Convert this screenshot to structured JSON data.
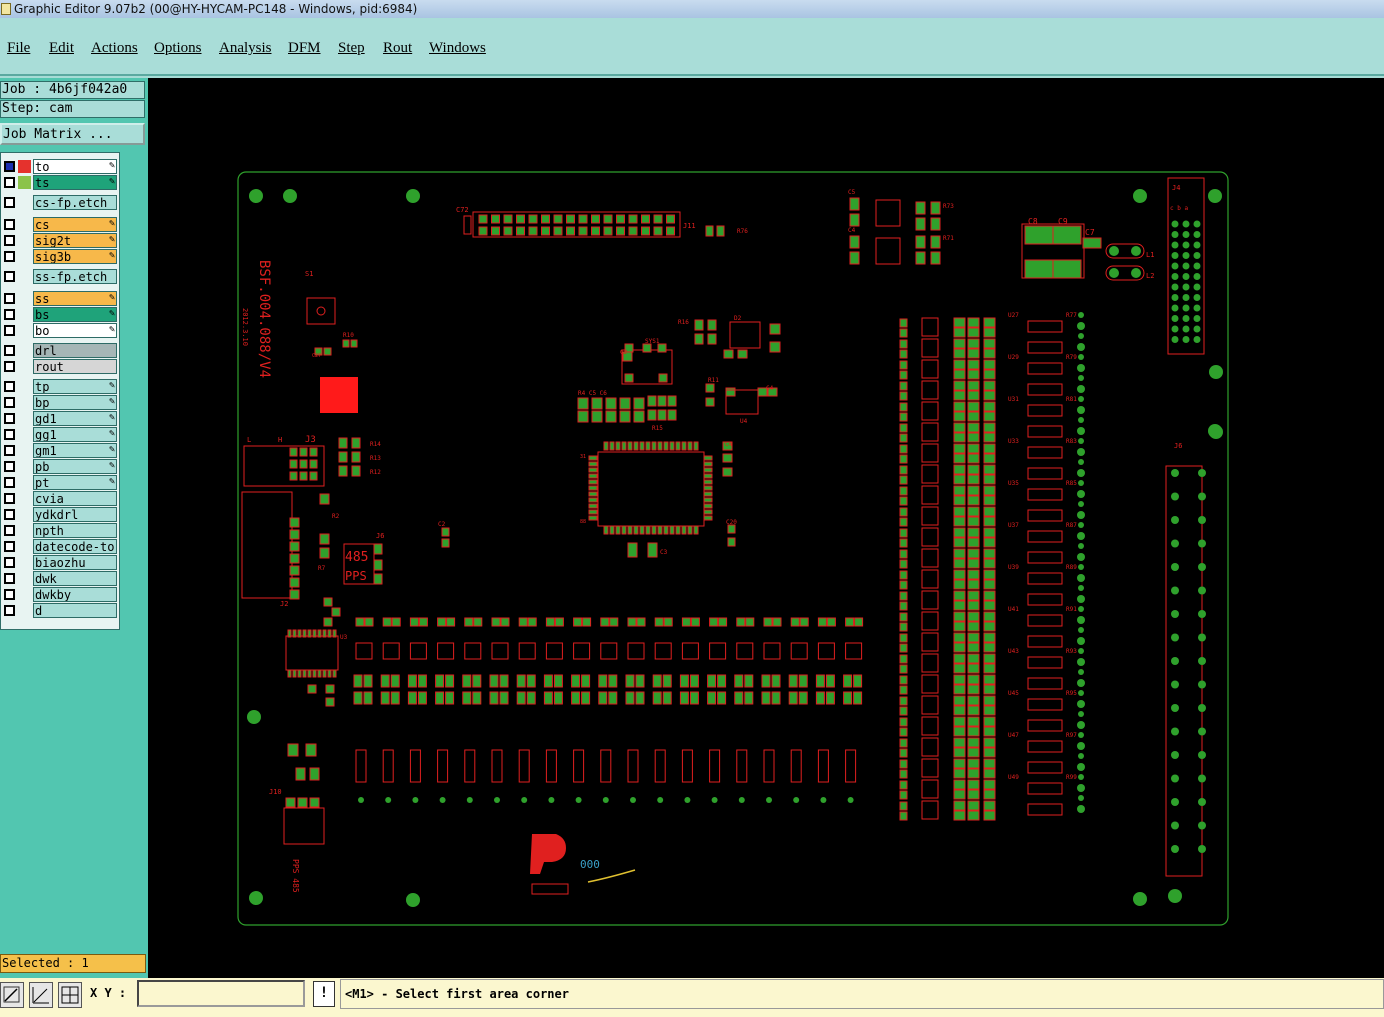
{
  "window": {
    "title": "Graphic Editor 9.07b2 (00@HY-HYCAM-PC148 - Windows, pid:6984)"
  },
  "menu": [
    "File",
    "Edit",
    "Actions",
    "Options",
    "Analysis",
    "DFM",
    "Step",
    "Rout",
    "Windows"
  ],
  "job": {
    "job_line": "Job : 4b6jf042a0",
    "step_line": "Step: cam",
    "matrix_button": "Job Matrix ..."
  },
  "layers": [
    {
      "name": "to",
      "color": "#ffffff"
    },
    {
      "name": "ts",
      "color": "#1fa37a"
    },
    {
      "name": "cs-fp.etch",
      "color": "#a9ddd8"
    },
    {
      "name": "cs",
      "color": "#f7b84a"
    },
    {
      "name": "sig2t",
      "color": "#f7b84a"
    },
    {
      "name": "sig3b",
      "color": "#f7b84a"
    },
    {
      "name": "ss-fp.etch",
      "color": "#a9ddd8"
    },
    {
      "name": "ss",
      "color": "#f7b84a"
    },
    {
      "name": "bs",
      "color": "#1fa37a"
    },
    {
      "name": "bo",
      "color": "#ffffff"
    },
    {
      "name": "drl",
      "color": "#a5b6b6"
    },
    {
      "name": "rout",
      "color": "#d6d6d6"
    },
    {
      "name": "tp",
      "color": "#a9ddd8"
    },
    {
      "name": "bp",
      "color": "#a9ddd8"
    },
    {
      "name": "gd1",
      "color": "#a9ddd8"
    },
    {
      "name": "gg1",
      "color": "#a9ddd8"
    },
    {
      "name": "gm1",
      "color": "#a9ddd8"
    },
    {
      "name": "pb",
      "color": "#a9ddd8"
    },
    {
      "name": "pt",
      "color": "#a9ddd8"
    },
    {
      "name": "cvia",
      "color": "#a9ddd8"
    },
    {
      "name": "ydkdrl",
      "color": "#a9ddd8"
    },
    {
      "name": "npth",
      "color": "#a9ddd8"
    },
    {
      "name": "datecode-to",
      "color": "#a9ddd8"
    },
    {
      "name": "biaozhu",
      "color": "#a9ddd8"
    },
    {
      "name": "dwk",
      "color": "#a9ddd8"
    },
    {
      "name": "dwkby",
      "color": "#a9ddd8"
    },
    {
      "name": "d",
      "color": "#a9ddd8"
    }
  ],
  "selected": "Selected : 1",
  "status": {
    "xy_label": "X Y :",
    "xy_value": "",
    "warn_symbol": "!",
    "prompt": "<M1> - Select first area corner"
  },
  "board": {
    "silk_text": "BSF.004.088/V4",
    "silk_date": "2012.3.10",
    "ic_refs": [
      "U1",
      "U2",
      "U3",
      "U4",
      "U5"
    ],
    "connector_refs": [
      "J1",
      "J2",
      "J3",
      "J4",
      "J5",
      "J6",
      "J10",
      "J11"
    ],
    "cap_refs": [
      "C72",
      "C7",
      "C8",
      "C9",
      "C42",
      "C4",
      "C20",
      "C21",
      "C3",
      "C2",
      "C6",
      "C5"
    ],
    "labels": [
      "485",
      "PPS",
      "L1",
      "L2",
      "S1",
      "SYS1",
      "ISP"
    ]
  },
  "colors": {
    "copper": "#e0201f",
    "pad": "#2fa12c",
    "outline": "#2fa12c",
    "silk_blue": "#3aa0c8"
  }
}
